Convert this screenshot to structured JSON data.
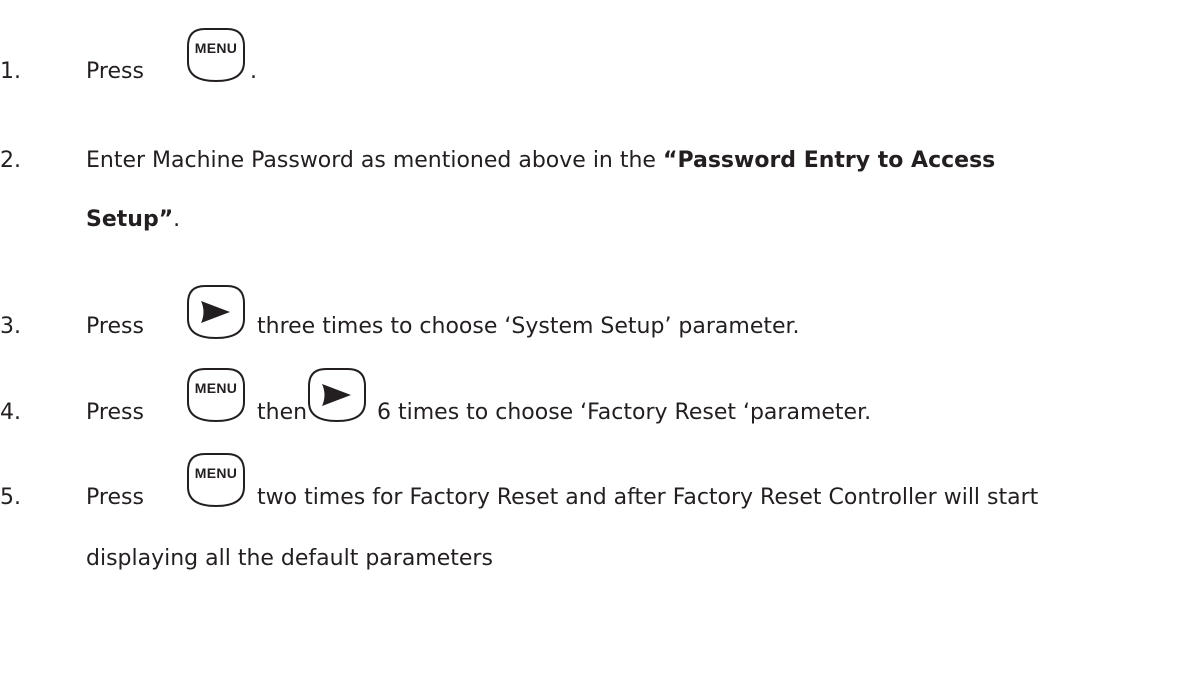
{
  "keys": {
    "menu": "MENU",
    "arrow_icon": "right-arrow-icon"
  },
  "steps": [
    {
      "number": "1.",
      "pre": "Press",
      "post": "."
    },
    {
      "number": "2.",
      "pre": "Enter Machine Password as mentioned above in the",
      "bold": "“Password Entry to Access",
      "bold2": "Setup”",
      "tail": "."
    },
    {
      "number": "3.",
      "pre": "Press",
      "post": "three times to choose ‘System Setup’ parameter."
    },
    {
      "number": "4.",
      "pre": "Press",
      "mid": "then",
      "post": "6 times to choose ‘Factory Reset ‘parameter."
    },
    {
      "number": "5.",
      "pre": "Press",
      "post": "two times for Factory Reset and after Factory Reset Controller will start",
      "line2": "displaying all the default parameters"
    }
  ]
}
